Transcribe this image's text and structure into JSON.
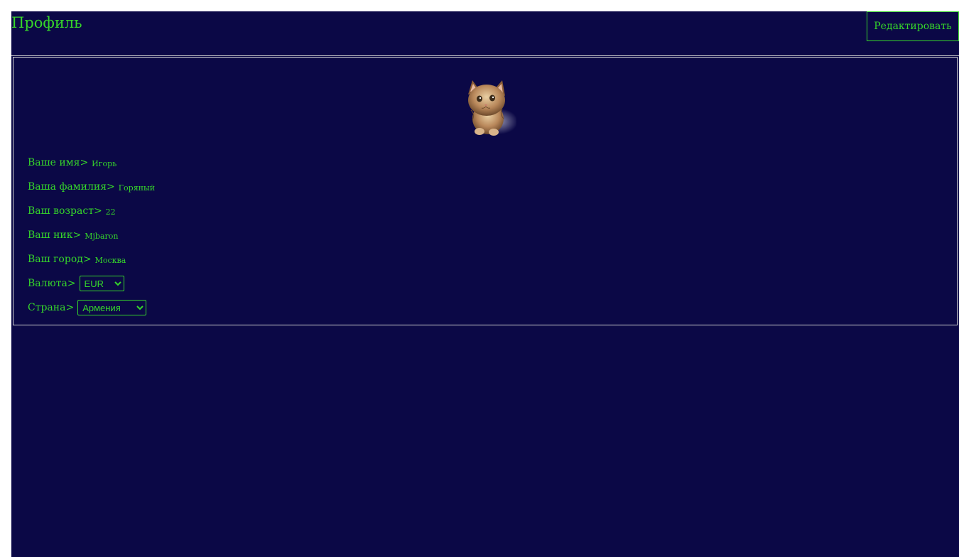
{
  "header": {
    "title": "Профиль",
    "edit_label": "Редактировать"
  },
  "colors": {
    "background": "#0b0846",
    "accent": "#36d62a",
    "border": "#d0d0d0"
  },
  "profile": {
    "avatar_icon": "kitten-avatar",
    "fields": [
      {
        "label": "Ваше имя>",
        "value": "Игорь"
      },
      {
        "label": "Ваша фамилия>",
        "value": "Горяный"
      },
      {
        "label": "Ваш возраст>",
        "value": "22"
      },
      {
        "label": "Ваш ник>",
        "value": "Mjbaron"
      },
      {
        "label": "Ваш город>",
        "value": "Москва"
      }
    ],
    "currency": {
      "label": "Валюта>",
      "selected": "EUR"
    },
    "country": {
      "label": "Страна>",
      "selected": "Армения"
    }
  }
}
